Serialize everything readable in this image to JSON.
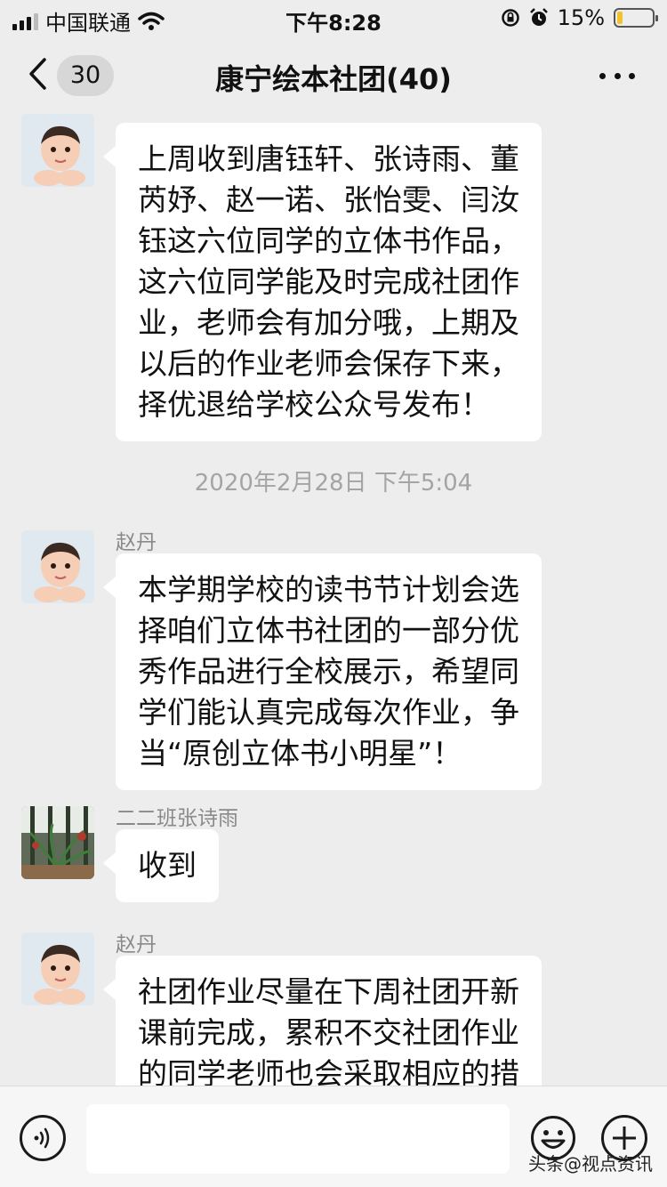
{
  "status_bar": {
    "carrier": "中国联通",
    "time": "下午8:28",
    "battery": "15%",
    "battery_level": 0.15
  },
  "nav": {
    "unread_count": "30",
    "title": "康宁绘本社团(40)"
  },
  "messages": [
    {
      "sender": "",
      "lines": [
        "上周收到唐钰轩、张诗雨、董",
        "芮妤、赵一诺、张怡雯、闫汝",
        "钰这六位同学的立体书作品，",
        "这六位同学能及时完成社团作",
        "业，老师会有加分哦，上期及",
        "以后的作业老师会保存下来，",
        "择优退给学校公众号发布！"
      ]
    },
    {
      "sender": "赵丹",
      "lines": [
        "本学期学校的读书节计划会选",
        "择咱们立体书社团的一部分优",
        "秀作品进行全校展示，希望同",
        "学们能认真完成每次作业，争",
        "当“原创立体书小明星”！"
      ]
    },
    {
      "sender": "二二班张诗雨",
      "lines": [
        "收到"
      ]
    },
    {
      "sender": "赵丹",
      "lines": [
        "社团作业尽量在下周社团开新",
        "课前完成，累积不交社团作业",
        "的同学老师也会采取相应的措"
      ]
    }
  ],
  "timestamp": "2020年2月28日 下午5:04",
  "input_bar": {
    "placeholder": ""
  },
  "watermark": "头条@视点资讯",
  "icons": [
    "signal-icon",
    "wifi-icon",
    "lock-rotation-icon",
    "alarm-icon",
    "battery-icon",
    "back-chevron-icon",
    "more-icon",
    "voice-icon",
    "emoji-icon",
    "plus-icon"
  ]
}
